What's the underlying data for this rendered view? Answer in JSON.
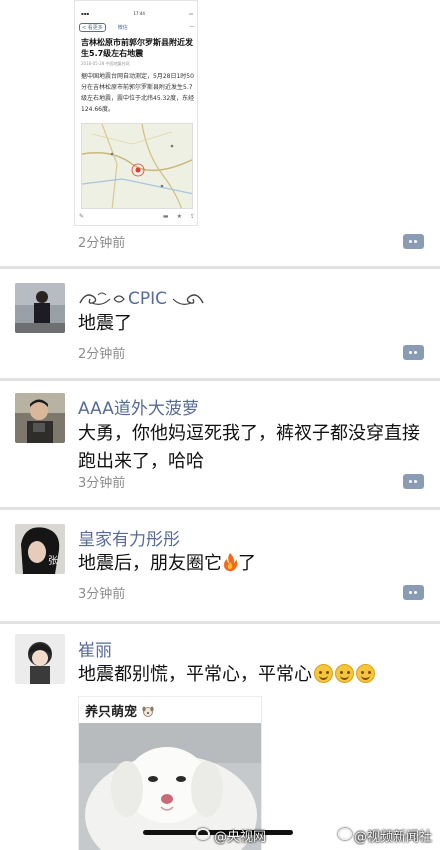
{
  "post0": {
    "article": {
      "status_time": "17:44",
      "back_label": "< 看更多",
      "nav_label": "微信",
      "title": "吉林松原市前郭尔罗斯县附近发生5.7级左右地震",
      "meta": "2018-05-28 中国地震台网",
      "body": "据中国地震台网自动测定，5月28日1时50分在吉林松原市前郭尔罗斯县附近发生5.7级左右地震，震中位于北纬45.32度，东经124.66度。"
    },
    "time": "2分钟前"
  },
  "posts": [
    {
      "name": "CPIC",
      "text": "地震了",
      "time": "2分钟前"
    },
    {
      "name": "AAA道外大菠萝",
      "text": "大勇，你他妈逗死我了，裤衩子都没穿直接跑出来了，哈哈",
      "time": "3分钟前"
    },
    {
      "name": "皇家有力彤彤",
      "text_before": "地震后，朋友圈它",
      "text_after": "了",
      "time": "3分钟前"
    },
    {
      "name": "崔丽",
      "text": "地震都别慌，平常心，平常心",
      "shared_label": "养只萌宠"
    }
  ],
  "watermark": {
    "left": "@央视网",
    "right": "@视频新闻社"
  }
}
